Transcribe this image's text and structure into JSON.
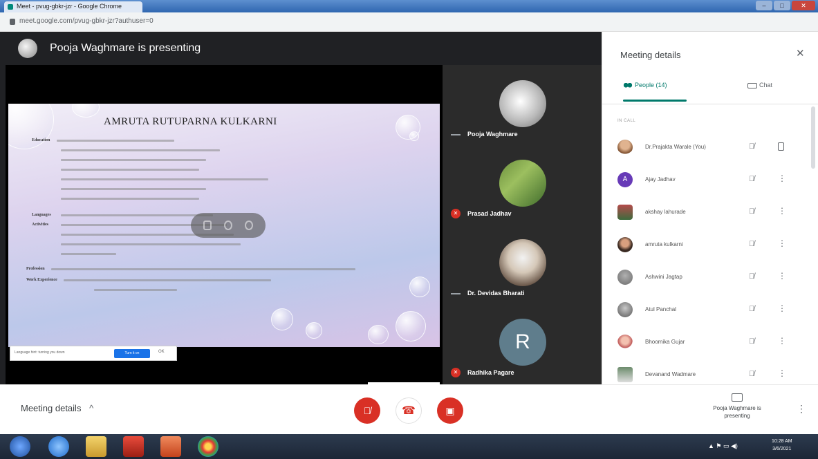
{
  "browser": {
    "tab_title": "Meet - pvug-gbkr-jzr - Google Chrome",
    "url": "meet.google.com/pvug-gbkr-jzr?authuser=0"
  },
  "stage": {
    "presenter_banner": "Pooja Waghmare is presenting",
    "slide": {
      "heading": "AMRUTA RUTUPARNA KULKARNI",
      "labels": [
        "Education",
        "Languages",
        "Activities",
        "Profession",
        "Work Experience"
      ]
    },
    "captions": {
      "text": "Language hint: turning you down",
      "button": "Turn it on",
      "dismiss": "OK"
    },
    "participants": [
      {
        "name": "Pooja Waghmare",
        "muted": false
      },
      {
        "name": "Prasad Jadhav",
        "muted": true
      },
      {
        "name": "Dr. Devidas Bharati",
        "muted": false
      },
      {
        "name": "Radhika Pagare",
        "muted": true,
        "initial": "R"
      }
    ]
  },
  "panel": {
    "title": "Meeting details",
    "close_icon": "✕",
    "tab_people": "People (14)",
    "tab_chat": "Chat",
    "section_label": "IN CALL",
    "people": [
      {
        "name": "Dr.Prajakta Warale (You)",
        "avatar_color": "#c98a5b"
      },
      {
        "name": "Ajay Jadhav",
        "initial": "A",
        "avatar_color": "#673ab7"
      },
      {
        "name": "akshay lahurade",
        "avatar_color": "#b54b4b"
      },
      {
        "name": "amruta kulkarni",
        "avatar_color": "#5a4034"
      },
      {
        "name": "Ashwini Jagtap",
        "avatar_color": "#888888"
      },
      {
        "name": "Atul Panchal",
        "avatar_color": "#777777"
      },
      {
        "name": "Bhoomika Gujar",
        "avatar_color": "#d36f6f"
      },
      {
        "name": "Devanand Wadmare",
        "avatar_color": "#6c8c6c"
      }
    ]
  },
  "bottom_bar": {
    "meeting_details_label": "Meeting details",
    "chevron_up": "^",
    "presenting_label": "Pooja Waghmare is presenting"
  },
  "taskbar": {
    "tray_text": "▲ ⚑ ▭ ◀)",
    "time": "10:28 AM",
    "date": "3/6/2021"
  },
  "colors": {
    "meet_red": "#d93025",
    "meet_teal": "#00796b",
    "stage_dark": "#202124"
  }
}
